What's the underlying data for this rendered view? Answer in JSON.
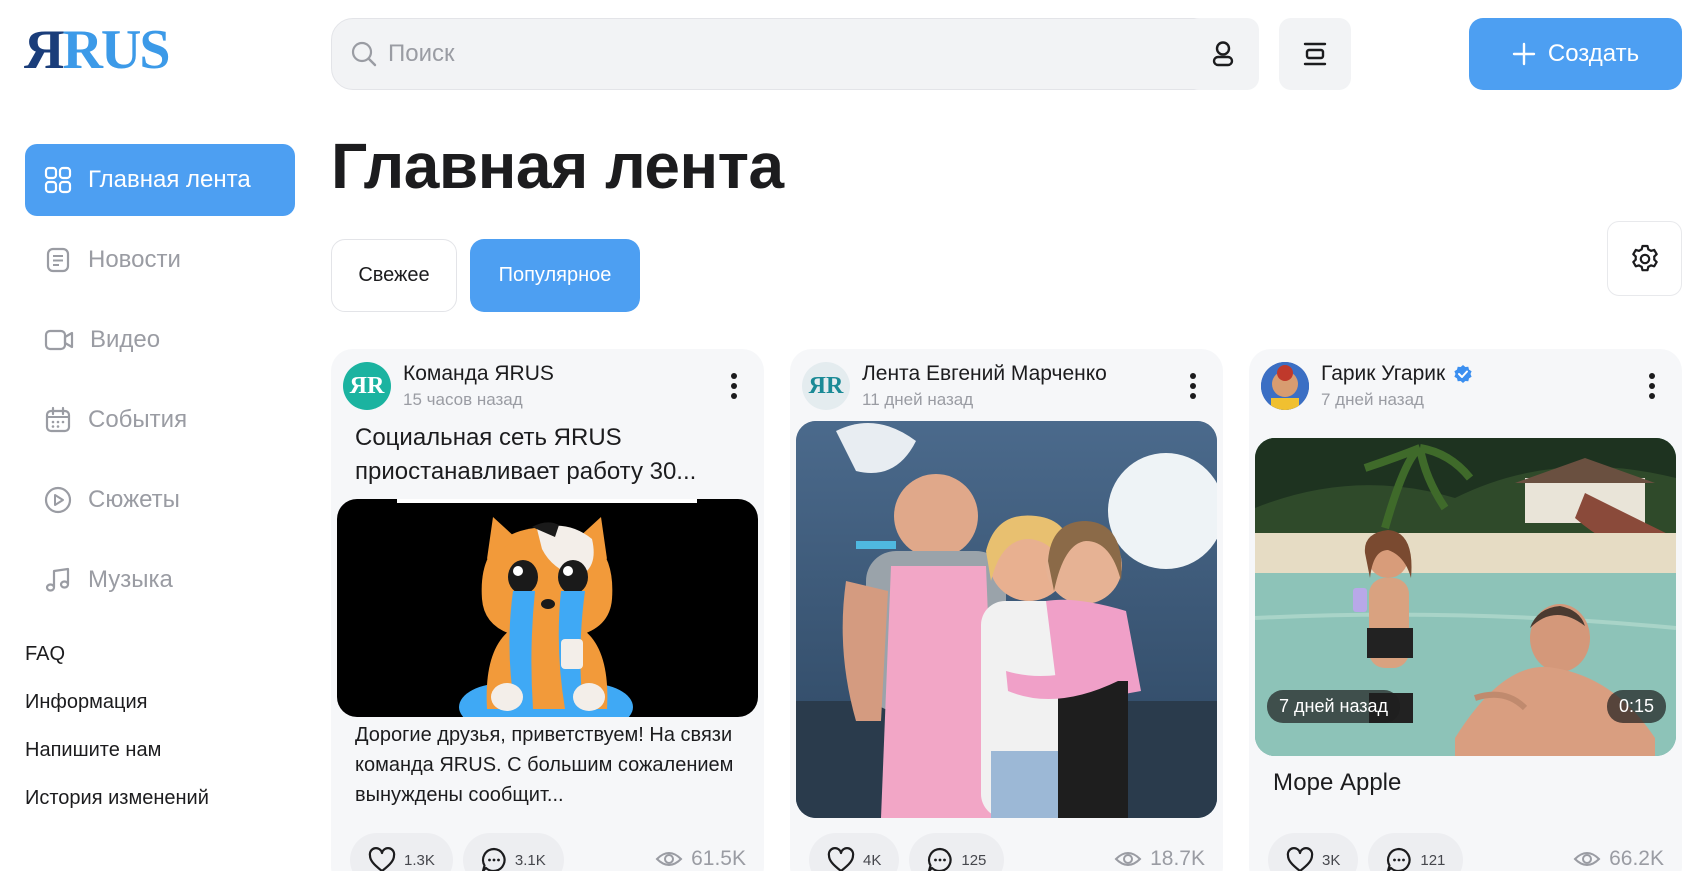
{
  "logo": {
    "ya": "Я",
    "rus": "RUS"
  },
  "search": {
    "placeholder": "Поиск"
  },
  "header": {
    "create_label": "Создать"
  },
  "sidebar": {
    "items": [
      {
        "label": "Главная лента",
        "icon": "grid-icon",
        "active": true
      },
      {
        "label": "Новости",
        "icon": "news-icon"
      },
      {
        "label": "Видео",
        "icon": "video-icon"
      },
      {
        "label": "События",
        "icon": "calendar-icon"
      },
      {
        "label": "Сюжеты",
        "icon": "play-circle-icon"
      },
      {
        "label": "Музыка",
        "icon": "music-note-icon"
      }
    ],
    "footer_links": [
      "FAQ",
      "Информация",
      "Напишите нам",
      "История изменений"
    ]
  },
  "main": {
    "title": "Главная лента",
    "tabs": [
      {
        "label": "Свежее",
        "active": false
      },
      {
        "label": "Популярное",
        "active": true
      }
    ]
  },
  "posts": [
    {
      "author": "Команда ЯRUS",
      "time": "15 часов назад",
      "title": "Социальная сеть ЯRUS приостанавливает работу 30...",
      "text": "Дорогие друзья, приветствуем! На связи команда ЯRUS. С большим сожалением вынуждены сообщит...",
      "likes": "1.3K",
      "comments": "3.1K",
      "views": "61.5K"
    },
    {
      "author": "Лента Евгений Марченко",
      "time": "11 дней назад",
      "likes": "4K",
      "comments": "125",
      "views": "18.7K"
    },
    {
      "author": "Гарик Угарик",
      "verified": true,
      "time": "7 дней назад",
      "video_time_label": "7 дней назад",
      "video_duration": "0:15",
      "title": "Море Apple",
      "likes": "3K",
      "comments": "121",
      "views": "66.2K"
    }
  ],
  "colors": {
    "accent": "#4d9ff2",
    "logo_dark": "#1a3d7a",
    "logo_light": "#3c9ae8"
  }
}
